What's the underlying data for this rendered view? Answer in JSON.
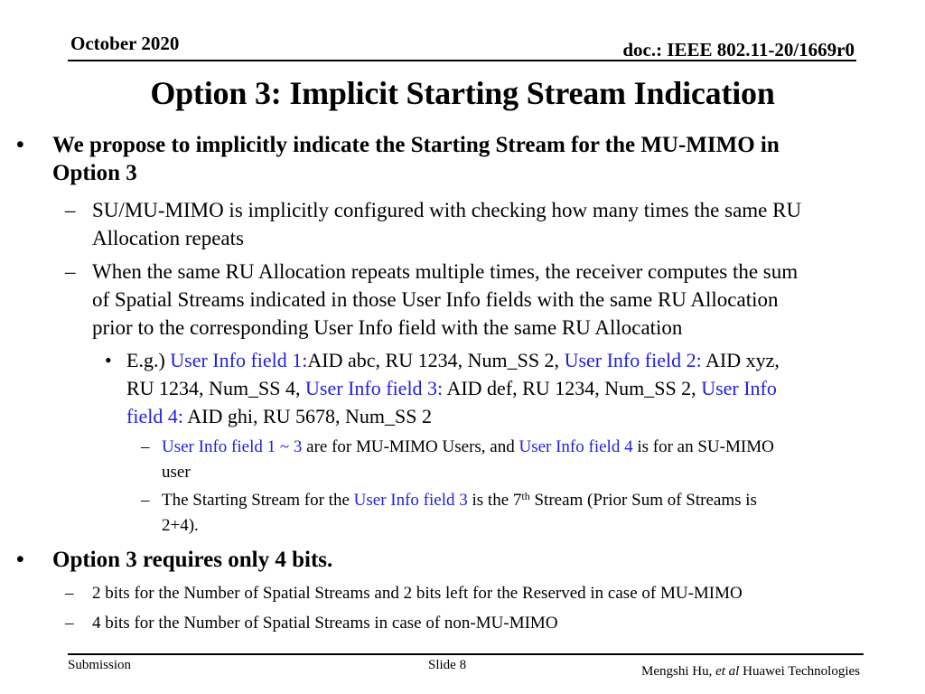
{
  "header": {
    "date": "October 2020",
    "doc_id": "doc.: IEEE 802.11-20/1669r0"
  },
  "title": "Option 3: Implicit Starting Stream Indication",
  "colors": {
    "accent_blue": "#2020e0",
    "text": "#000000"
  },
  "bullets": {
    "b1": {
      "marker": "•",
      "line1": "We propose to implicitly indicate the Starting Stream for the MU-MIMO in",
      "line2": "Option 3"
    },
    "b1_1": {
      "marker": "–",
      "line1": "SU/MU-MIMO is implicitly configured with checking how many times the same RU",
      "line2": "Allocation repeats"
    },
    "b1_2": {
      "marker": "–",
      "line1": "When the same RU Allocation repeats multiple times, the receiver computes the sum",
      "line2": "of Spatial Streams indicated in those User Info fields with the same RU Allocation",
      "line3": "prior to the corresponding User Info field with the same RU Allocation"
    },
    "b1_2_1": {
      "marker": "•",
      "seg1": "E.g.) ",
      "seg2_blue": "User Info field 1:",
      "seg3": "AID abc, RU 1234, Num_SS 2, ",
      "seg4_blue": "User Info field 2:",
      "seg5": " AID xyz,",
      "seg6": "RU 1234, Num_SS 4, ",
      "seg7_blue": "User Info field 3:",
      "seg8": " AID def, RU 1234, Num_SS 2, ",
      "seg9_blue": "User Info",
      "seg10_blue": "field 4:",
      "seg11": " AID ghi, RU 5678, Num_SS 2"
    },
    "b1_2_1_1": {
      "marker": "–",
      "seg1_blue": "User Info field 1 ~ 3",
      "seg2": " are for MU-MIMO Users, and ",
      "seg3_blue": "User Info field 4",
      "seg4": " is for an SU-MIMO",
      "seg5": "user"
    },
    "b1_2_1_2": {
      "marker": "–",
      "seg1": "The Starting Stream for the ",
      "seg2_blue": "User Info field 3",
      "seg3": " is the 7",
      "sup": "th",
      "seg4": " Stream (Prior Sum of Streams is",
      "seg5": "2+4)."
    },
    "b2": {
      "marker": "•",
      "line1": "Option 3 requires only 4 bits."
    },
    "b2_1": {
      "marker": "–",
      "line1": "2 bits for the Number of Spatial Streams and  2 bits left for the Reserved in case of MU-MIMO"
    },
    "b2_2": {
      "marker": "–",
      "line1": "4 bits for the Number of Spatial Streams in case of non-MU-MIMO"
    }
  },
  "footer": {
    "left": "Submission",
    "slide": "Slide 8",
    "author": "Mengshi Hu, ",
    "author_italic": "et al",
    "affiliation": " Huawei Technologies"
  }
}
